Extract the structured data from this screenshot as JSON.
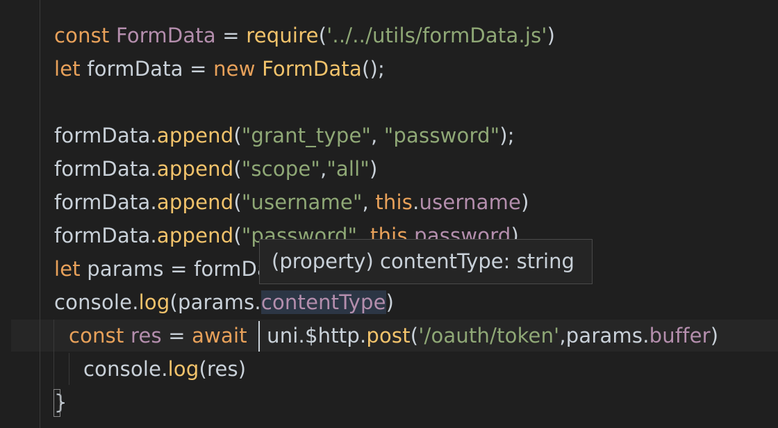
{
  "editor": {
    "lines": [
      [
        {
          "t": "const ",
          "c": "kw"
        },
        {
          "t": "FormData",
          "c": "cls"
        },
        {
          "t": " = ",
          "c": "txt"
        },
        {
          "t": "require",
          "c": "fn"
        },
        {
          "t": "(",
          "c": "txt"
        },
        {
          "t": "'../../utils/formData.js'",
          "c": "str"
        },
        {
          "t": ")",
          "c": "txt"
        }
      ],
      [
        {
          "t": "let ",
          "c": "kw"
        },
        {
          "t": "formData = ",
          "c": "txt"
        },
        {
          "t": "new ",
          "c": "kw"
        },
        {
          "t": "FormData",
          "c": "fn"
        },
        {
          "t": "();",
          "c": "txt"
        }
      ],
      [],
      [
        {
          "t": "formData.",
          "c": "txt"
        },
        {
          "t": "append",
          "c": "fn"
        },
        {
          "t": "(",
          "c": "txt"
        },
        {
          "t": "\"grant_type\"",
          "c": "str"
        },
        {
          "t": ", ",
          "c": "txt"
        },
        {
          "t": "\"password\"",
          "c": "str"
        },
        {
          "t": ");",
          "c": "txt"
        }
      ],
      [
        {
          "t": "formData.",
          "c": "txt"
        },
        {
          "t": "append",
          "c": "fn"
        },
        {
          "t": "(",
          "c": "txt"
        },
        {
          "t": "\"scope\"",
          "c": "str"
        },
        {
          "t": ",",
          "c": "txt"
        },
        {
          "t": "\"all\"",
          "c": "str"
        },
        {
          "t": ")",
          "c": "txt"
        }
      ],
      [
        {
          "t": "formData.",
          "c": "txt"
        },
        {
          "t": "append",
          "c": "fn"
        },
        {
          "t": "(",
          "c": "txt"
        },
        {
          "t": "\"username\"",
          "c": "str"
        },
        {
          "t": ", ",
          "c": "txt"
        },
        {
          "t": "this",
          "c": "kw"
        },
        {
          "t": ".",
          "c": "txt"
        },
        {
          "t": "username",
          "c": "prop"
        },
        {
          "t": ")",
          "c": "txt"
        }
      ],
      [
        {
          "t": "formData.",
          "c": "txt"
        },
        {
          "t": "append",
          "c": "fn"
        },
        {
          "t": "(",
          "c": "txt"
        },
        {
          "t": "\"password\"",
          "c": "str"
        },
        {
          "t": ", ",
          "c": "txt"
        },
        {
          "t": "this",
          "c": "kw"
        },
        {
          "t": ".",
          "c": "txt"
        },
        {
          "t": "password",
          "c": "prop"
        },
        {
          "t": ")",
          "c": "txt"
        }
      ],
      [
        {
          "t": "let ",
          "c": "kw"
        },
        {
          "t": "params = formData",
          "c": "txt"
        }
      ],
      [
        {
          "t": "console.",
          "c": "txt"
        },
        {
          "t": "log",
          "c": "fn"
        },
        {
          "t": "(params.",
          "c": "txt"
        },
        {
          "t": "contentType",
          "c": "prop sel"
        },
        {
          "t": ")",
          "c": "txt"
        }
      ],
      [
        {
          "t": "const ",
          "c": "kw"
        },
        {
          "t": "res",
          "c": "cls"
        },
        {
          "t": " = ",
          "c": "txt"
        },
        {
          "t": "await",
          "c": "kw"
        },
        {
          "t": "   ",
          "c": "txt"
        },
        {
          "t": "uni.$http.",
          "c": "txt"
        },
        {
          "t": "post",
          "c": "fn"
        },
        {
          "t": "(",
          "c": "txt"
        },
        {
          "t": "'/oauth/token'",
          "c": "str"
        },
        {
          "t": ",params.",
          "c": "txt"
        },
        {
          "t": "buffer",
          "c": "prop"
        },
        {
          "t": ")",
          "c": "txt"
        }
      ],
      [
        {
          "t": "console.",
          "c": "txt"
        },
        {
          "t": "log",
          "c": "fn"
        },
        {
          "t": "(res)",
          "c": "txt"
        }
      ],
      [
        {
          "t": "}",
          "c": "txt"
        }
      ]
    ]
  },
  "hover": {
    "kind": "(property)",
    "name": "contentType",
    "sep": ":",
    "type": "string"
  },
  "colors": {
    "background": "#1f1f1f",
    "keyword": "#e8a15a",
    "function": "#f2c36b",
    "string": "#8fa876",
    "property": "#b48ead",
    "text": "#c9d1d9"
  }
}
